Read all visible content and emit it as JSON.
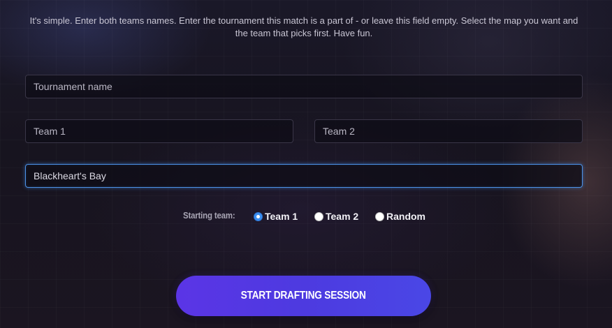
{
  "intro": {
    "text": "It's simple. Enter both teams names. Enter the tournament this match is a part of - or leave this field empty. Select the map you want and the team that picks first. Have fun."
  },
  "form": {
    "tournament": {
      "value": "",
      "placeholder": "Tournament name"
    },
    "team1": {
      "value": "",
      "placeholder": "Team 1"
    },
    "team2": {
      "value": "",
      "placeholder": "Team 2"
    },
    "map": {
      "value": "Blackheart's Bay",
      "placeholder": ""
    }
  },
  "starting_team": {
    "label": "Starting team:",
    "options": [
      {
        "label": "Team 1",
        "checked": true
      },
      {
        "label": "Team 2",
        "checked": false
      },
      {
        "label": "Random",
        "checked": false
      }
    ]
  },
  "actions": {
    "start_label": "START DRAFTING SESSION"
  },
  "colors": {
    "accent": "#4c92e8",
    "button": "#5236e3",
    "radio_checked": "#3b8ef0"
  }
}
